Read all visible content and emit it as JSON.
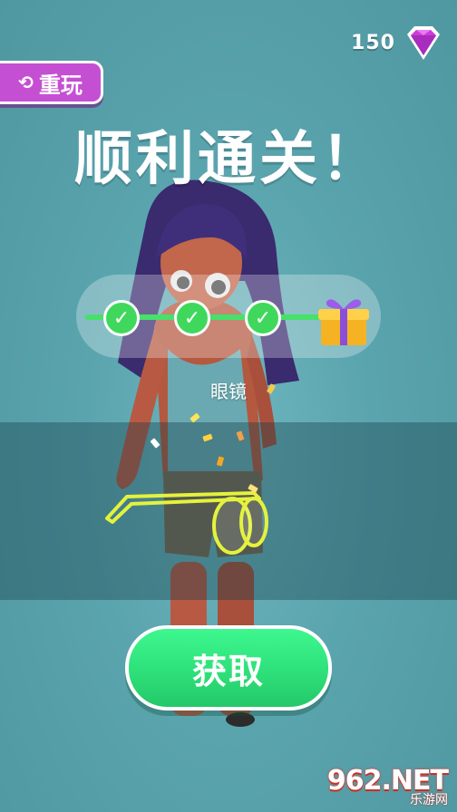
{
  "gems": {
    "count": "150",
    "color": "#cc3bd6"
  },
  "replay": {
    "label": "重玩",
    "icon": "replay-icon"
  },
  "title": "顺利通关！",
  "progress": {
    "checks": [
      "check",
      "check",
      "check"
    ],
    "reward_icon": "gift-icon"
  },
  "reward": {
    "item_label": "眼镜",
    "item_icon": "glasses-icon"
  },
  "acquire": {
    "label": "获取"
  },
  "watermark": {
    "brand": "962.NET",
    "sub": "乐游网"
  }
}
